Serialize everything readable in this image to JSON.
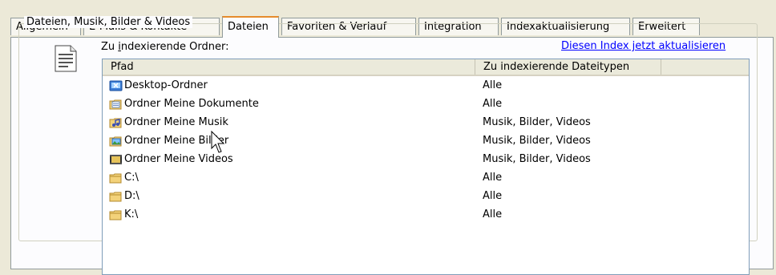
{
  "tabs": [
    {
      "label": "Allgemein",
      "active": false
    },
    {
      "label": "E-Mails & Kontakte",
      "active": false
    },
    {
      "label": "Dateien",
      "active": true
    },
    {
      "label": "Favoriten & Verlauf",
      "active": false
    },
    {
      "label": "Integration",
      "active": false
    },
    {
      "label": "Indexaktualisierung",
      "active": false
    },
    {
      "label": "Erweitert",
      "active": false
    }
  ],
  "group": {
    "title": "Dateien, Musik, Bilder & Videos",
    "icon": "document-icon",
    "folders_label_pre": "Zu ",
    "folders_label_accel": "i",
    "folders_label_post": "ndexierende Ordner:",
    "update_link": "Diesen Index jetzt aktualisieren"
  },
  "table": {
    "columns": [
      "Pfad",
      "Zu indexierende Dateitypen"
    ],
    "rows": [
      {
        "path": "Desktop-Ordner",
        "types": "Alle",
        "icon": "desktop-folder-icon"
      },
      {
        "path": "Ordner Meine Dokumente",
        "types": "Alle",
        "icon": "my-documents-folder-icon"
      },
      {
        "path": "Ordner Meine Musik",
        "types": "Musik, Bilder, Videos",
        "icon": "my-music-folder-icon"
      },
      {
        "path": "Ordner Meine Bilder",
        "types": "Musik, Bilder, Videos",
        "icon": "my-pictures-folder-icon"
      },
      {
        "path": "Ordner Meine Videos",
        "types": "Musik, Bilder, Videos",
        "icon": "my-videos-folder-icon"
      },
      {
        "path": "C:\\",
        "types": "Alle",
        "icon": "drive-folder-icon"
      },
      {
        "path": "D:\\",
        "types": "Alle",
        "icon": "drive-folder-icon"
      },
      {
        "path": "K:\\",
        "types": "Alle",
        "icon": "drive-folder-icon"
      }
    ]
  },
  "colors": {
    "accent_tab": "#e68b2c",
    "link": "#0000ff",
    "window": "#ece9d8"
  }
}
